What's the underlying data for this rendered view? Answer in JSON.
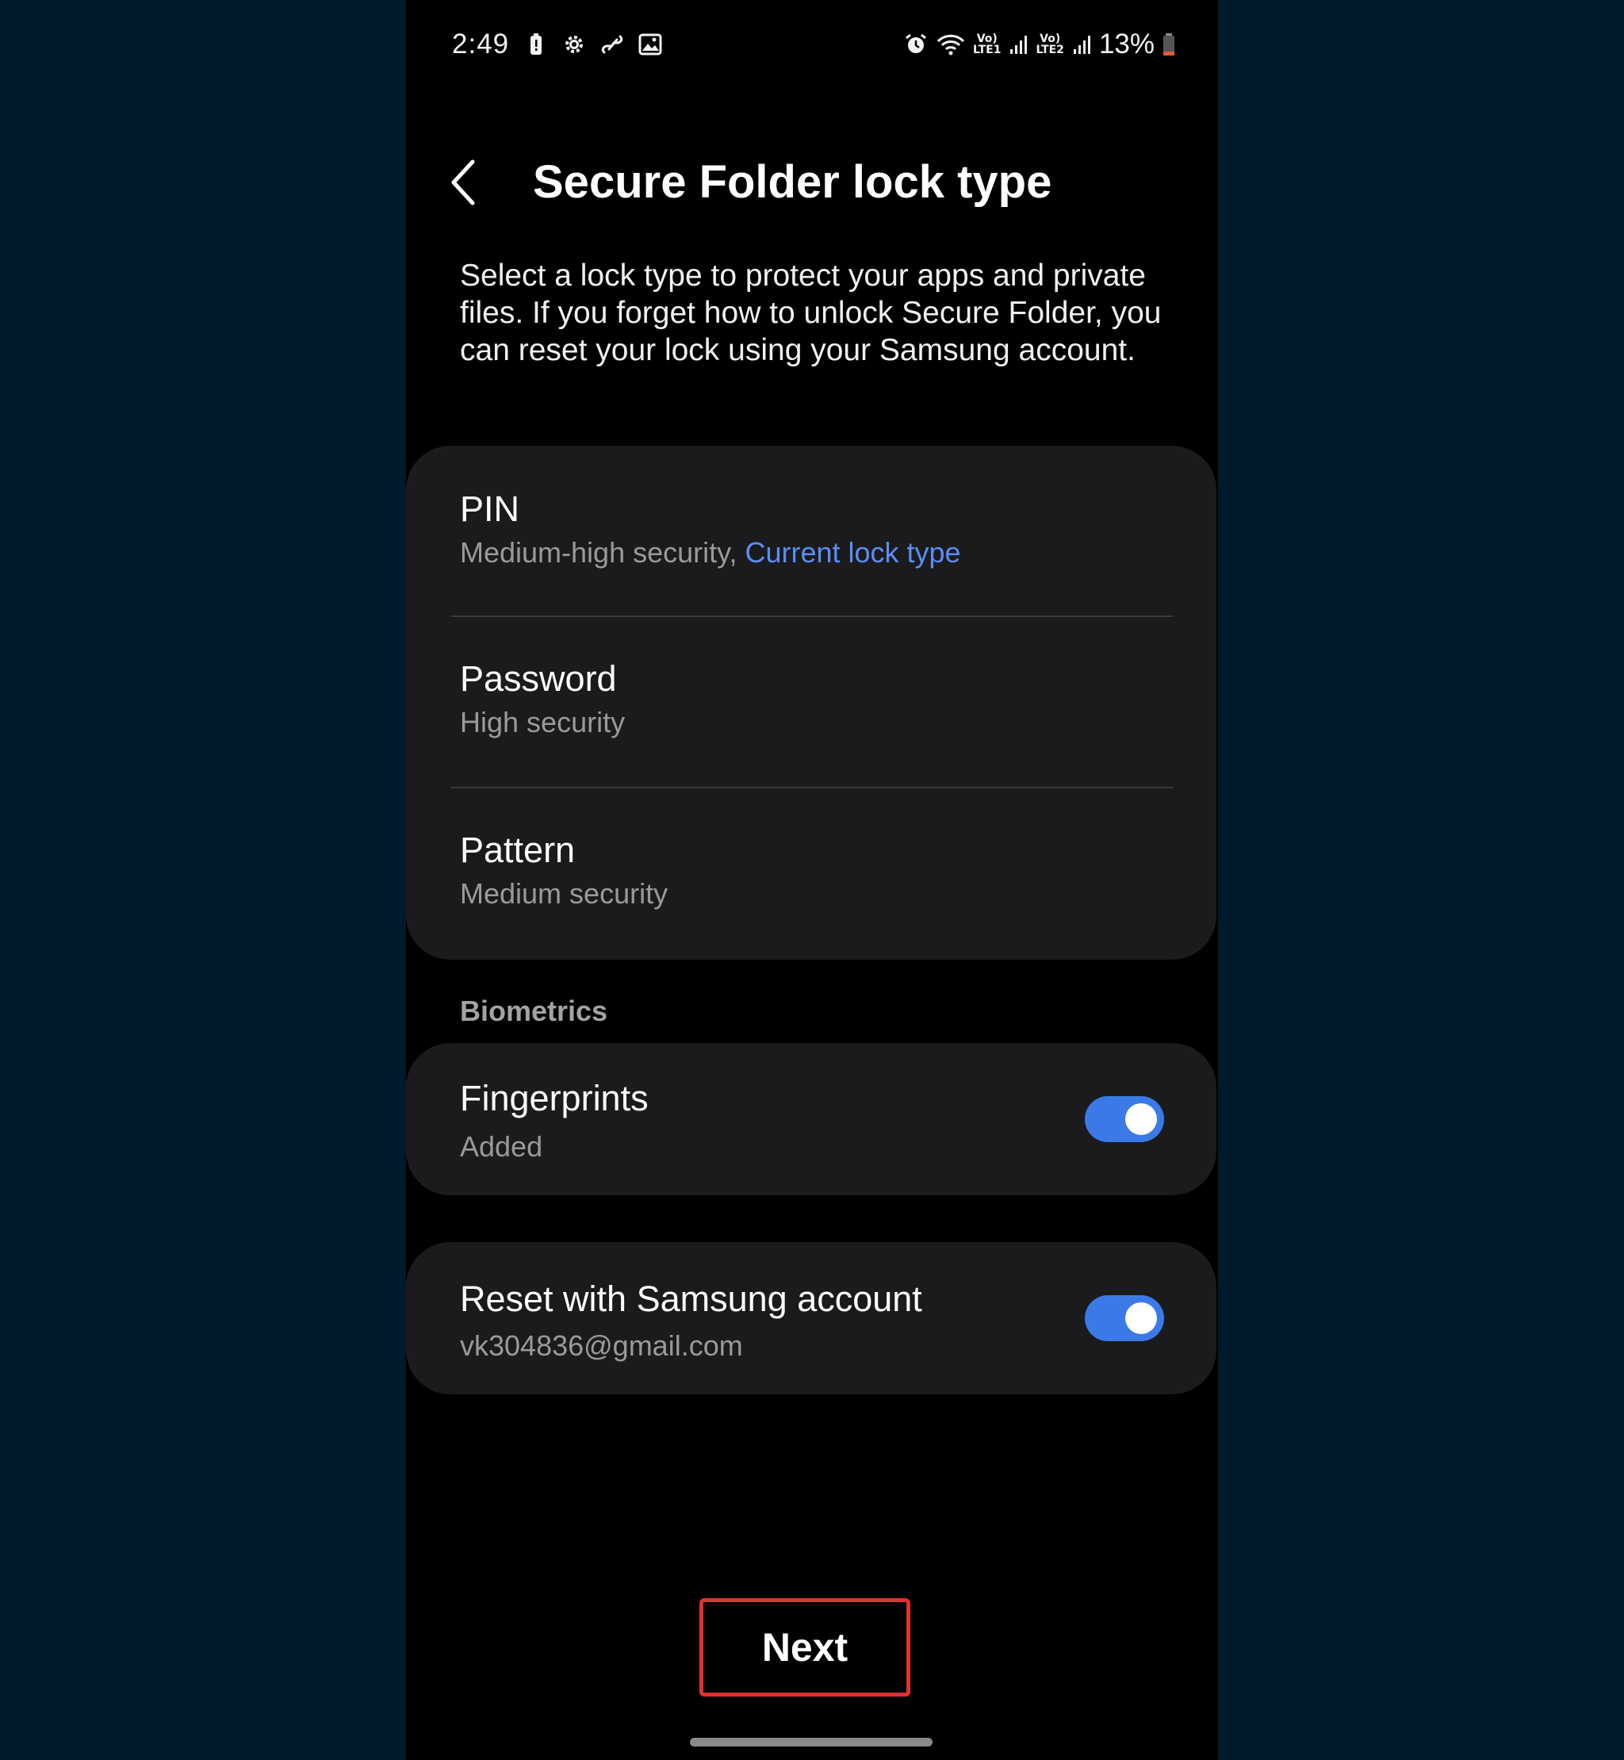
{
  "status_bar": {
    "time": "2:49",
    "battery_percent": "13%",
    "net1_top": "Vo)",
    "net1_bottom": "LTE1",
    "net2_top": "Vo)",
    "net2_bottom": "LTE2",
    "left_icons": [
      "battery-saver-icon",
      "settings-gear-icon",
      "link-icon",
      "gallery-icon"
    ],
    "right_icons": [
      "alarm-icon",
      "wifi-icon",
      "signal-icon",
      "signal-icon",
      "battery-low-icon"
    ]
  },
  "header": {
    "title": "Secure Folder lock type",
    "back_icon": "chevron-left-icon"
  },
  "description": "Select a lock type to protect your apps and private files. If you forget how to unlock Secure Folder, you can reset your lock using your Samsung account.",
  "lock_types": [
    {
      "title": "PIN",
      "subtitle": "Medium-high security,",
      "accent": "Current lock type"
    },
    {
      "title": "Password",
      "subtitle": "High security"
    },
    {
      "title": "Pattern",
      "subtitle": "Medium security"
    }
  ],
  "biometrics": {
    "section_label": "Biometrics",
    "fingerprints_title": "Fingerprints",
    "fingerprints_subtitle": "Added",
    "fingerprints_enabled": true
  },
  "reset": {
    "title": "Reset with Samsung account",
    "subtitle": "vk304836@gmail.com",
    "enabled": true
  },
  "next_button": "Next",
  "colors": {
    "accent_blue": "#5b8ef4",
    "toggle_on": "#3b7ae6",
    "highlight_red": "#e03131",
    "card_bg": "#1b1b1d",
    "outer_bg": "#011a2b"
  }
}
